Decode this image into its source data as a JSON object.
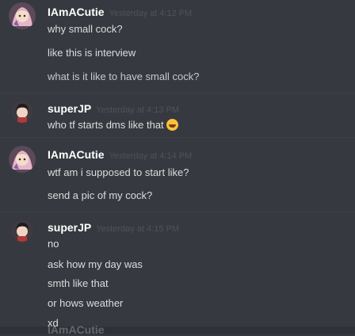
{
  "messages": [
    {
      "username": "IAmACutie",
      "timestamp": "Yesterday at 4:12 PM",
      "lines": [
        "why small cock?",
        "like this is interview",
        "what is it like to have small cock?"
      ]
    },
    {
      "username": "superJP",
      "timestamp": "Yesterday at 4:13 PM",
      "lines": [
        "who tf starts dms like that"
      ]
    },
    {
      "username": "IAmACutie",
      "timestamp": "Yesterday at 4:14 PM",
      "lines": [
        "wtf am i supposed to start like?",
        "send a pic of my cock?"
      ]
    },
    {
      "username": "superJP",
      "timestamp": "Yesterday at 4:15 PM",
      "lines": [
        "no",
        "ask how my day was",
        "smth like that",
        "or hows weather",
        "xd"
      ]
    }
  ],
  "partial_username": "IAmACutie",
  "icons": {
    "cutie_avatar": "anime-girl-avatar-icon",
    "superjp_avatar": "dark-hair-avatar-icon",
    "emoji": "rofl-emoji-icon"
  },
  "colors": {
    "background": "#36393f",
    "username": "#ffffff",
    "text": "#dcddde",
    "timestamp": "#4f535a"
  }
}
